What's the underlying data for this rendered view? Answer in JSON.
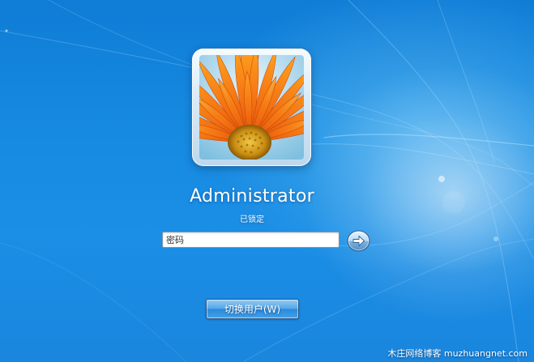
{
  "user": {
    "name": "Administrator",
    "status": "已锁定"
  },
  "password": {
    "placeholder": "密码",
    "value": ""
  },
  "buttons": {
    "submit_icon": "arrow-right-icon",
    "switch_user_label": "切换用户(W)"
  },
  "avatar": {
    "picture": "orange-flower-photo"
  },
  "watermark": {
    "text": "木庄网络博客 muzhuangnet.com"
  },
  "colors": {
    "background": "#1b8ee5",
    "petal": "#f36f12",
    "flower_center": "#d9a21c",
    "frame": "#d9ebf8"
  }
}
